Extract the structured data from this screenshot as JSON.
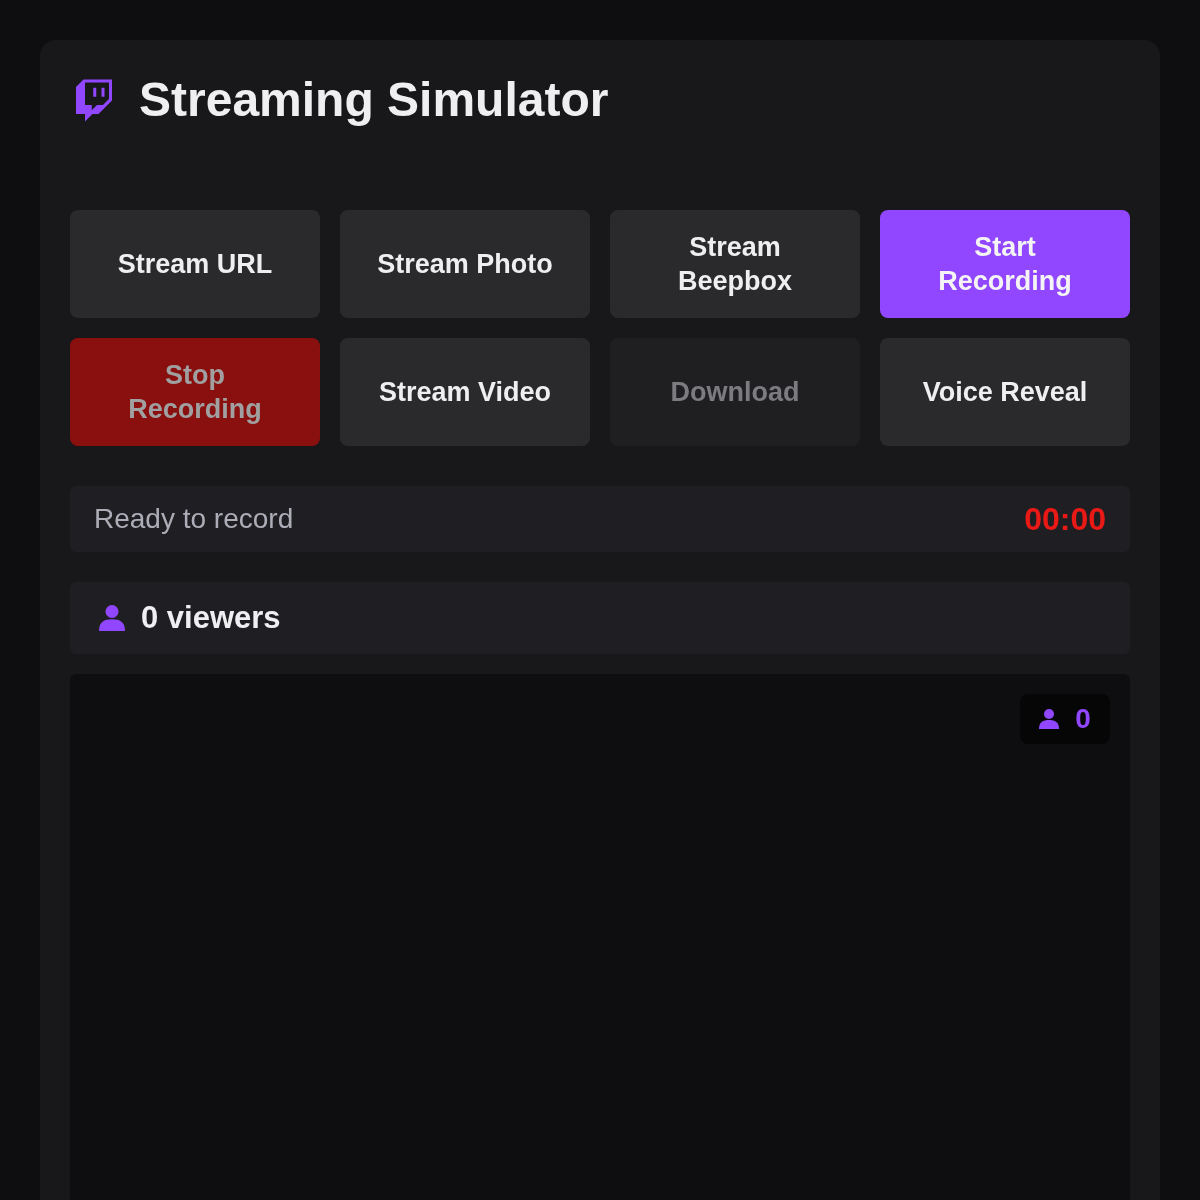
{
  "header": {
    "title": "Streaming Simulator"
  },
  "buttons": [
    {
      "label": "Stream URL",
      "kind": "default",
      "disabled": false
    },
    {
      "label": "Stream Photo",
      "kind": "default",
      "disabled": false
    },
    {
      "label": "Stream Beepbox",
      "kind": "default",
      "disabled": false
    },
    {
      "label": "Start Recording",
      "kind": "primary",
      "disabled": false
    },
    {
      "label": "Stop Recording",
      "kind": "danger",
      "disabled": true
    },
    {
      "label": "Stream Video",
      "kind": "default",
      "disabled": false
    },
    {
      "label": "Download",
      "kind": "default",
      "disabled": true
    },
    {
      "label": "Voice Reveal",
      "kind": "default",
      "disabled": false
    }
  ],
  "status": {
    "message": "Ready to record",
    "timer": "00:00"
  },
  "viewers": {
    "label": "0 viewers"
  },
  "stream_view": {
    "viewer_badge": "0"
  }
}
